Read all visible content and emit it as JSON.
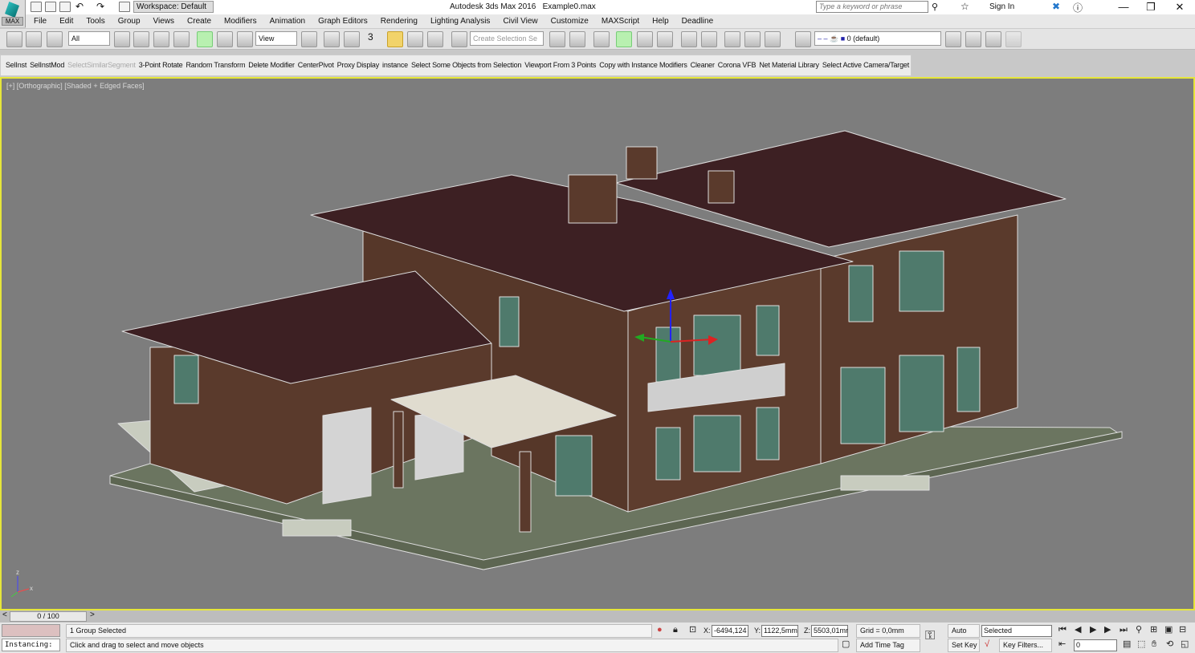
{
  "app": {
    "logo_text": "MAX",
    "workspace": "Workspace: Default",
    "title": "Autodesk 3ds Max 2016",
    "file": "Example0.max",
    "search_placeholder": "Type a keyword or phrase",
    "sign_in": "Sign In"
  },
  "window_controls": {
    "minimize": "—",
    "restore": "❐",
    "close": "✕"
  },
  "menu": [
    "File",
    "Edit",
    "Tools",
    "Group",
    "Views",
    "Create",
    "Modifiers",
    "Animation",
    "Graph Editors",
    "Rendering",
    "Lighting Analysis",
    "Civil View",
    "Customize",
    "MAXScript",
    "Help",
    "Deadline"
  ],
  "toolbar": {
    "selection_filter": "All",
    "reference_coord": "View",
    "named_selection_placeholder": "Create Selection Se",
    "layer": "0 (default)",
    "snap_label": "3"
  },
  "commands": [
    {
      "label": "SelInst"
    },
    {
      "label": "SelInstMod"
    },
    {
      "label": "SelectSimilarSegment",
      "disabled": true
    },
    {
      "label": "3-Point Rotate"
    },
    {
      "label": "Random Transform"
    },
    {
      "label": "Delete Modifier"
    },
    {
      "label": "CenterPivot"
    },
    {
      "label": "Proxy Display"
    },
    {
      "label": "instance"
    },
    {
      "label": "Select Some Objects from Selection"
    },
    {
      "label": "Viewport From 3 Points"
    },
    {
      "label": "Copy with Instance Modifiers"
    },
    {
      "label": "Cleaner"
    },
    {
      "label": "Corona VFB"
    },
    {
      "label": "Net Material Library"
    },
    {
      "label": "Select Active Camera/Target"
    }
  ],
  "viewport": {
    "label": "[+] [Orthographic] [Shaded + Edged Faces]",
    "background": "#7d7d7d",
    "active_border": "#e6e63a",
    "axis_x": "x",
    "axis_z": "z"
  },
  "timeline": {
    "frame": "0 / 100",
    "prev": "<",
    "next": ">"
  },
  "status": {
    "maxscript_listener": "Instancing:",
    "selection": "1 Group Selected",
    "prompt": "Click and drag to select and move objects",
    "x_label": "X:",
    "x": "-6494,124",
    "y_label": "Y:",
    "y": "1122,5mm",
    "z_label": "Z:",
    "z": "5503,01mr",
    "grid": "Grid = 0,0mm",
    "add_time_tag": "Add Time Tag",
    "auto_key": "Auto Key",
    "set_key": "Set Key",
    "key_mode": "Selected",
    "key_filters": "Key Filters...",
    "current_frame": "0"
  },
  "colors": {
    "roof": "#3d2023",
    "wall": "#5a3a2c",
    "trim": "#e6e6e6",
    "glass": "#4f7a6c",
    "ground": "#6b7560"
  }
}
